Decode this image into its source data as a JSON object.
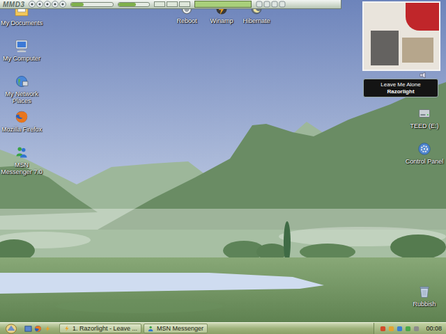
{
  "player": {
    "logo": "MMD3",
    "seek_level": 0.3,
    "volume_level": 0.55
  },
  "left_icons": [
    {
      "label": "My Documents",
      "kind": "documents"
    },
    {
      "label": "My Computer",
      "kind": "computer"
    },
    {
      "label": "My Network Places",
      "kind": "network"
    },
    {
      "label": "Mozilla Firefox",
      "kind": "firefox"
    },
    {
      "label": "MSN Messenger 7.0",
      "kind": "msn"
    }
  ],
  "top_icons": [
    {
      "label": "Reboot",
      "kind": "reboot"
    },
    {
      "label": "Winamp",
      "kind": "winamp"
    },
    {
      "label": "Hibernate",
      "kind": "hibernate"
    }
  ],
  "right_icons": [
    {
      "label": "TEED (E:)",
      "kind": "drive"
    },
    {
      "label": "Control Panel",
      "kind": "control"
    }
  ],
  "bin_icons": [
    {
      "label": "Rubbish",
      "kind": "recycle"
    }
  ],
  "now_playing": {
    "title": "Leave Me Alone",
    "artist": "Razorlight"
  },
  "taskbar": {
    "tasks": [
      {
        "label": "1. Razorlight - Leave ...",
        "selected": false,
        "kind": "winamp"
      },
      {
        "label": "MSN Messenger",
        "selected": false,
        "kind": "msn"
      }
    ],
    "clock": "00:08"
  }
}
